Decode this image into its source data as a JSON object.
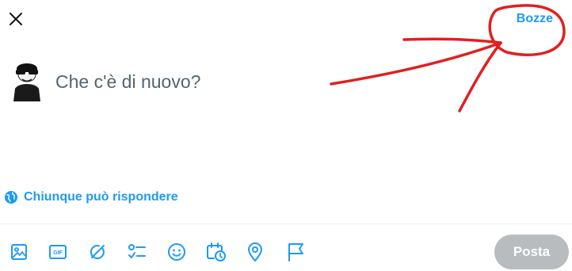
{
  "header": {
    "close_icon": "close-icon",
    "drafts_label": "Bozze"
  },
  "composer": {
    "placeholder": "Che c'è di nuovo?",
    "value": "",
    "avatar": "user-avatar"
  },
  "reply_setting": {
    "label": "Chiunque può rispondere",
    "icon": "globe-icon"
  },
  "toolbar": {
    "tools": [
      {
        "name": "media-icon"
      },
      {
        "name": "gif-icon",
        "text": "GIF"
      },
      {
        "name": "grok-icon"
      },
      {
        "name": "poll-icon"
      },
      {
        "name": "emoji-icon"
      },
      {
        "name": "schedule-icon"
      },
      {
        "name": "location-icon"
      },
      {
        "name": "flag-icon"
      }
    ],
    "post_label": "Posta"
  },
  "colors": {
    "accent": "#1d9bf0",
    "post_disabled": "#b9bcbf",
    "annotation": "#e02020"
  }
}
